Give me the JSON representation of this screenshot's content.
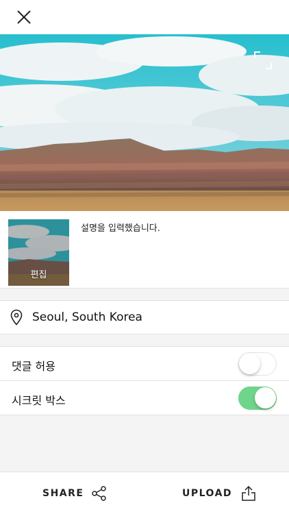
{
  "header": {
    "close_icon": "close-icon"
  },
  "photo": {
    "expand_icon": "expand-icon"
  },
  "caption": {
    "thumbnail_label": "편집",
    "text": "설명을 입력했습니다."
  },
  "location": {
    "icon": "location-pin-icon",
    "label": "Seoul, South Korea"
  },
  "settings": [
    {
      "label": "댓글 허용",
      "enabled": false
    },
    {
      "label": "시크릿 박스",
      "enabled": true
    }
  ],
  "bottom_bar": {
    "share_label": "SHARE",
    "share_icon": "share-icon",
    "upload_label": "UPLOAD",
    "upload_icon": "upload-icon"
  },
  "colors": {
    "toggle_on": "#6fd58a",
    "sky": "#2fc1cf"
  }
}
